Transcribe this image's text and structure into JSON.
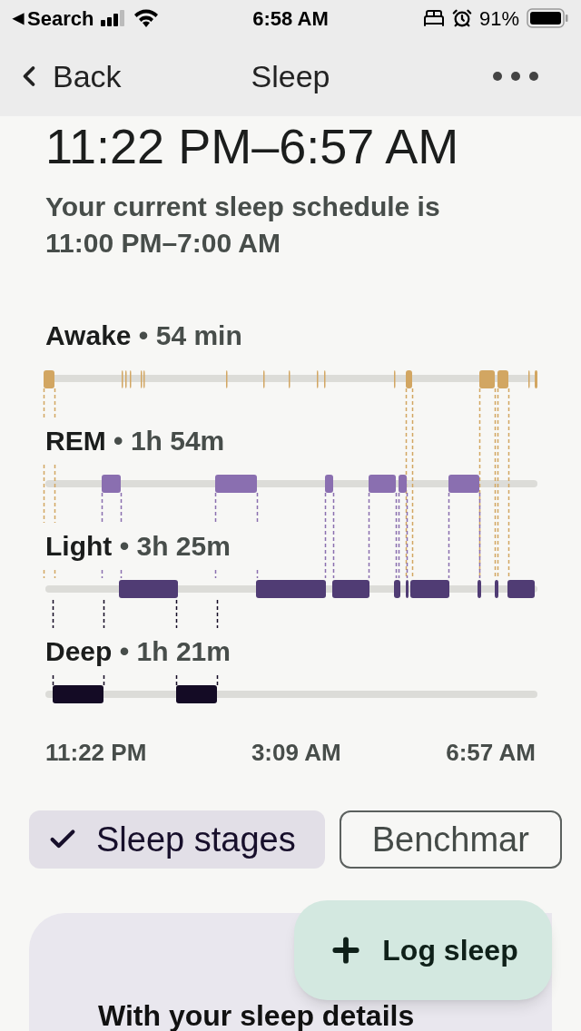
{
  "status_bar": {
    "back_glyph": "◀",
    "back_label": "Search",
    "time": "6:58 AM",
    "battery": "91%"
  },
  "nav": {
    "back": "Back",
    "title": "Sleep"
  },
  "time_range": "11:22 PM–6:57 AM",
  "schedule": "Your current sleep schedule is 11:00 PM–7:00 AM",
  "stages": [
    {
      "name": "Awake",
      "separator": "•",
      "duration": "54 min",
      "color": "#d2a662"
    },
    {
      "name": "REM",
      "separator": "•",
      "duration": "1h 54m",
      "color": "#8a6fb0"
    },
    {
      "name": "Light",
      "separator": "•",
      "duration": "3h 25m",
      "color": "#503c74"
    },
    {
      "name": "Deep",
      "separator": "•",
      "duration": "1h 21m",
      "color": "#140b25"
    }
  ],
  "axis_labels": [
    "11:22 PM",
    "3:09 AM",
    "6:57 AM"
  ],
  "chips": [
    {
      "label": "Sleep stages",
      "selected": true
    },
    {
      "label": "Benchmar",
      "selected": false
    }
  ],
  "fab": {
    "label": "Log sleep"
  },
  "card": {
    "text": "With your sleep details"
  }
}
